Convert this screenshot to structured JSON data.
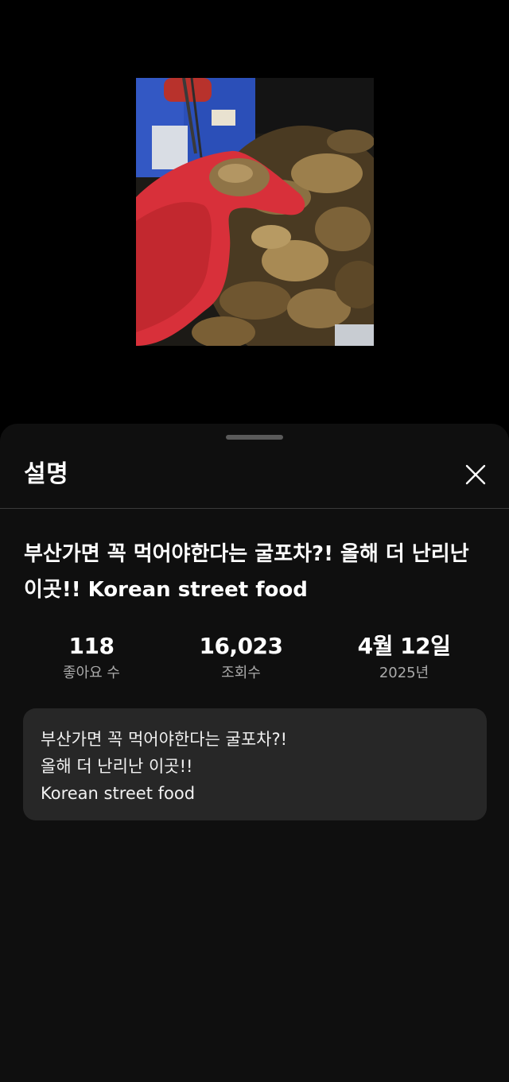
{
  "video": {
    "thumbnail_alt": "oysters held in red rubber gloves"
  },
  "sheet": {
    "title": "설명",
    "close_icon": "close-icon"
  },
  "video_title": "부산가면 꼭 먹어야한다는 굴포차?! 올해 더 난리난 이곳!! Korean street food",
  "stats": [
    {
      "value": "118",
      "label": "좋아요 수"
    },
    {
      "value": "16,023",
      "label": "조회수"
    },
    {
      "value": "4월 12일",
      "label": "2025년"
    }
  ],
  "description": {
    "lines": [
      "부산가면 꼭 먹어야한다는 굴포차?!",
      "올해 더 난리난 이곳!!",
      "Korean street food"
    ]
  },
  "colors": {
    "background": "#000000",
    "sheet": "#0f0f0f",
    "description_box": "#272727",
    "secondary_text": "#aaaaaa",
    "glove_red": "#d8303a"
  }
}
